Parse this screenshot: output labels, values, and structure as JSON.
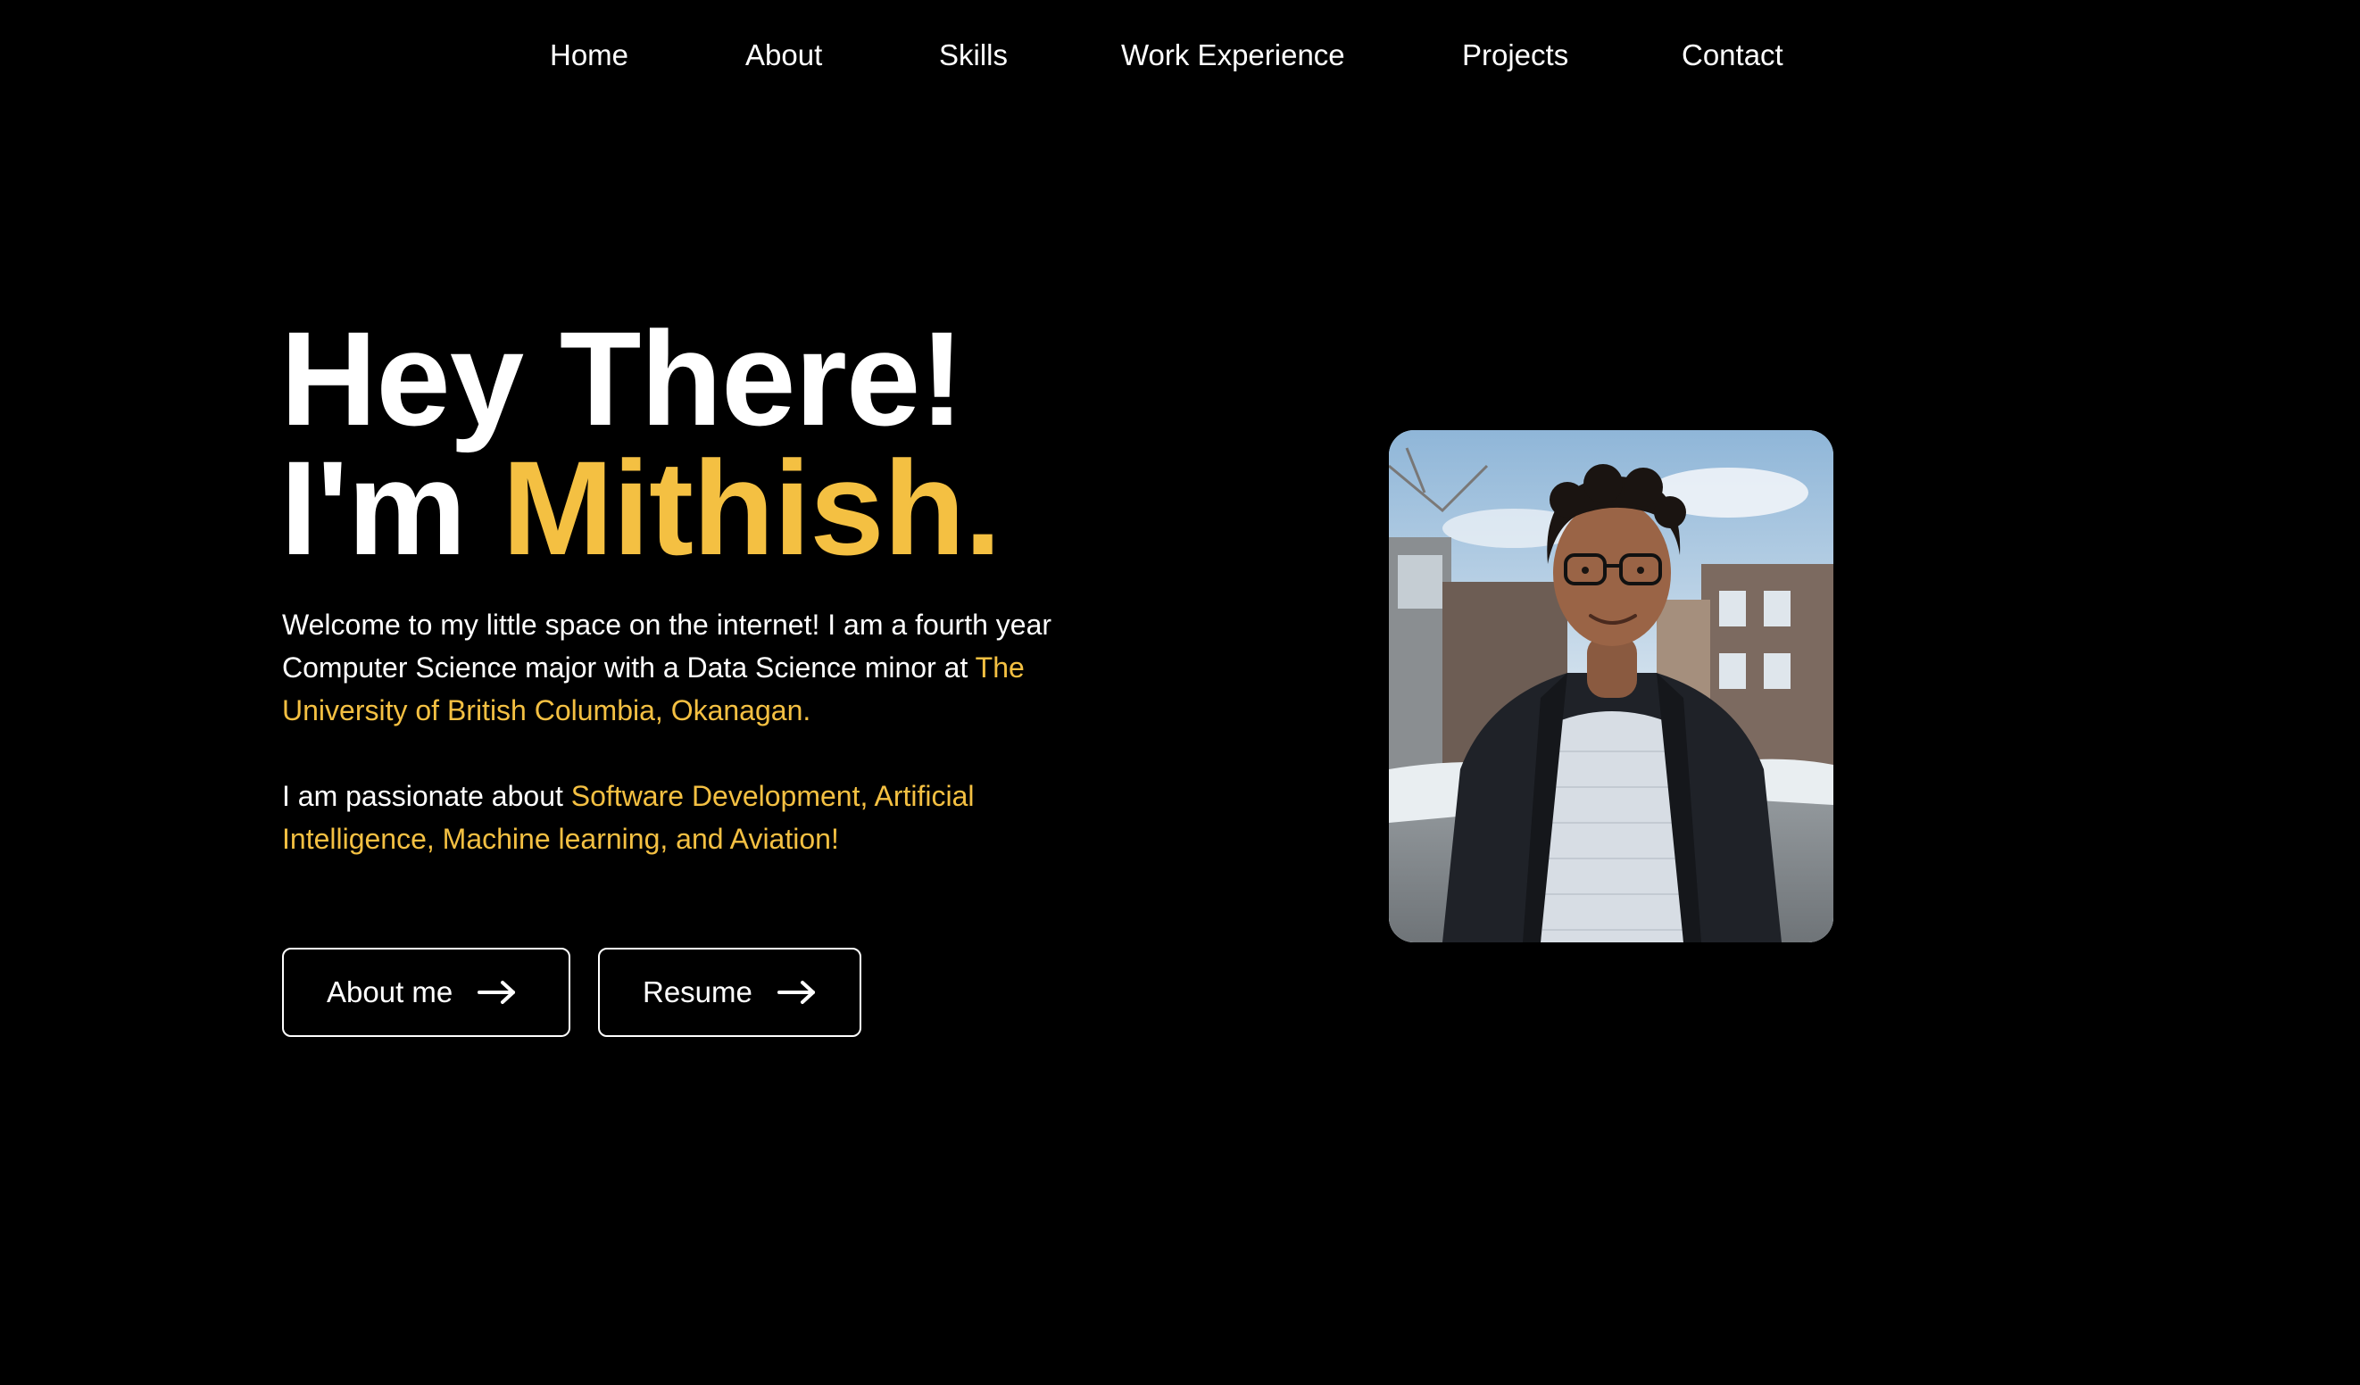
{
  "nav": {
    "items": [
      {
        "label": "Home"
      },
      {
        "label": "About"
      },
      {
        "label": "Skills"
      },
      {
        "label": "Work Experience"
      },
      {
        "label": "Projects"
      },
      {
        "label": "Contact"
      }
    ]
  },
  "hero": {
    "line1": "Hey There!",
    "line2_prefix": "I'm ",
    "name": "Mithish."
  },
  "intro": {
    "text": "Welcome to my little space on the internet! I am a fourth year Computer Science major with a Data Science minor at ",
    "university": "The University of British Columbia, Okanagan."
  },
  "passion": {
    "prefix": "I am passionate about ",
    "topics": "Software Development, Artificial Intelligence, Machine learning, and Aviation!"
  },
  "buttons": {
    "about_label": "About me",
    "resume_label": "Resume",
    "arrow_icon": "arrow-right-icon"
  },
  "colors": {
    "background": "#000000",
    "text": "#ffffff",
    "accent": "#f4c042"
  }
}
